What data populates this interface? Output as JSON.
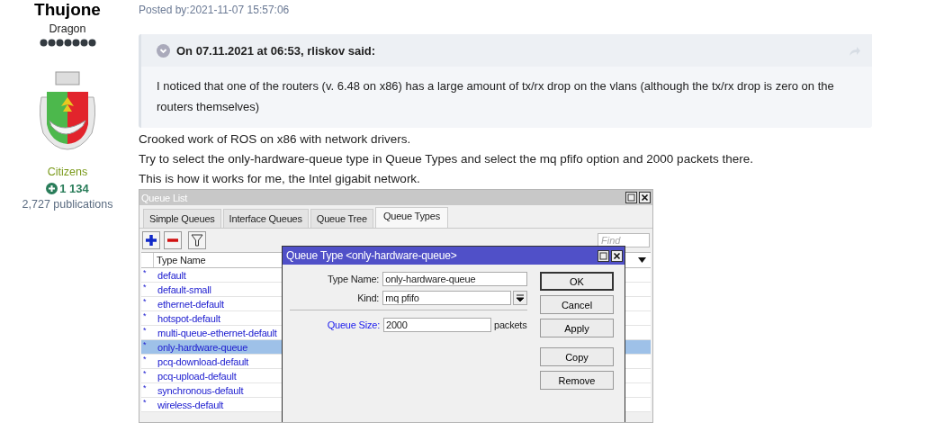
{
  "author": {
    "name": "Thujone",
    "rank": "Dragon",
    "group": "Citizens",
    "reputation": "1 134",
    "publications": "2,727 publications"
  },
  "post": {
    "posted": "Posted by:2021-11-07 15:57:06",
    "quote": {
      "header": "On 07.11.2021 at 06:53, rliskov said:",
      "text": "I noticed that one of the routers (v. 6.48 on x86) has a large amount of tx/rx drop on the vlans (although the tx/rx drop is zero on the routers themselves)"
    },
    "paragraphs": [
      "Crooked work of ROS on x86 with network drivers.",
      "Try to select the only-hardware-queue type in Queue Types and select the mq pfifo option and 2000 packets there.",
      "This is how it works for me, the Intel gigabit network."
    ]
  },
  "queue_list": {
    "title": "Queue List",
    "tabs": [
      {
        "label": "Simple Queues",
        "selected": false
      },
      {
        "label": "Interface Queues",
        "selected": false
      },
      {
        "label": "Queue Tree",
        "selected": false
      },
      {
        "label": "Queue Types",
        "selected": true
      }
    ],
    "find_placeholder": "Find",
    "column": "Type Name",
    "rows": [
      {
        "flag": "*",
        "name": "default",
        "selected": false
      },
      {
        "flag": "*",
        "name": "default-small",
        "selected": false
      },
      {
        "flag": "*",
        "name": "ethernet-default",
        "selected": false
      },
      {
        "flag": "*",
        "name": "hotspot-default",
        "selected": false
      },
      {
        "flag": "*",
        "name": "multi-queue-ethernet-default",
        "selected": false
      },
      {
        "flag": "*",
        "name": "only-hardware-queue",
        "selected": true
      },
      {
        "flag": "*",
        "name": "pcq-download-default",
        "selected": false
      },
      {
        "flag": "*",
        "name": "pcq-upload-default",
        "selected": false
      },
      {
        "flag": "*",
        "name": "synchronous-default",
        "selected": false
      },
      {
        "flag": "*",
        "name": "wireless-default",
        "selected": false
      }
    ]
  },
  "dialog": {
    "title": "Queue Type <only-hardware-queue>",
    "type_name_label": "Type Name:",
    "type_name": "only-hardware-queue",
    "kind_label": "Kind:",
    "kind": "mq pfifo",
    "size_label": "Queue Size:",
    "size": "2000",
    "size_unit": "packets",
    "buttons": [
      {
        "label": "OK",
        "default": true
      },
      {
        "label": "Cancel",
        "default": false
      },
      {
        "label": "Apply",
        "default": false
      },
      {
        "label": "Copy",
        "default": false
      },
      {
        "label": "Remove",
        "default": false
      }
    ]
  }
}
